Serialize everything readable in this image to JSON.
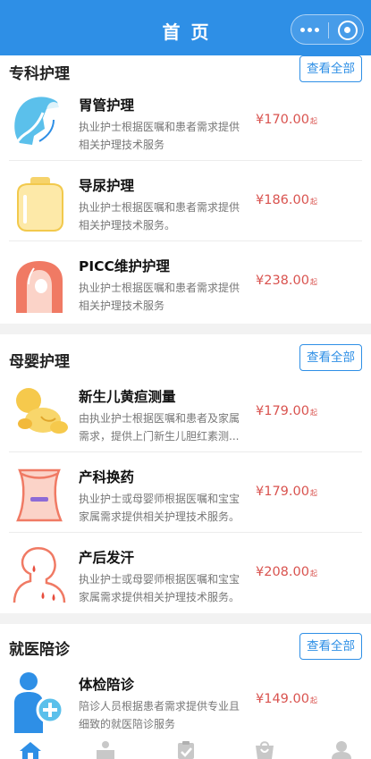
{
  "header": {
    "title": "首页"
  },
  "sections": [
    {
      "title": "专科护理",
      "view_all": "查看全部",
      "items": [
        {
          "name": "胃管护理",
          "desc": "执业护士根据医嘱和患者需求提供相关护理技术服务",
          "price": "¥170.00",
          "unit": "起",
          "icon": "stomach-tube-icon"
        },
        {
          "name": "导尿护理",
          "desc": "执业护士根据医嘱和患者需求提供相关护理技术服务。",
          "price": "¥186.00",
          "unit": "起",
          "icon": "catheter-bag-icon"
        },
        {
          "name": "PICC维护护理",
          "desc": "执业护士根据医嘱和患者需求提供相关护理技术服务",
          "price": "¥238.00",
          "unit": "起",
          "icon": "picc-arm-icon"
        }
      ]
    },
    {
      "title": "母婴护理",
      "view_all": "查看全部",
      "items": [
        {
          "name": "新生儿黄疸测量",
          "desc": "由执业护士根据医嘱和患者及家属需求，提供上门新生儿胆红素测...",
          "price": "¥179.00",
          "unit": "起",
          "icon": "newborn-icon"
        },
        {
          "name": "产科换药",
          "desc": "执业护士或母婴师根据医嘱和宝宝家属需求提供相关护理技术服务。",
          "price": "¥179.00",
          "unit": "起",
          "icon": "abdomen-dressing-icon"
        },
        {
          "name": "产后发汗",
          "desc": "执业护士或母婴师根据医嘱和宝宝家属需求提供相关护理技术服务。",
          "price": "¥208.00",
          "unit": "起",
          "icon": "sweating-icon"
        }
      ]
    },
    {
      "title": "就医陪诊",
      "view_all": "查看全部",
      "items": [
        {
          "name": "体检陪诊",
          "desc": "陪诊人员根据患者需求提供专业且细致的就医陪诊服务",
          "price": "¥149.00",
          "unit": "起",
          "icon": "escort-person-icon"
        }
      ]
    }
  ],
  "tabbar": {
    "icons": [
      "home-icon",
      "service-desk-icon",
      "order-clipboard-icon",
      "bag-icon",
      "profile-icon"
    ],
    "active_color": "#2e8fe6",
    "inactive_color": "#c8c8c8"
  },
  "colors": {
    "brand": "#2e8fe6",
    "price": "#d9534f"
  }
}
